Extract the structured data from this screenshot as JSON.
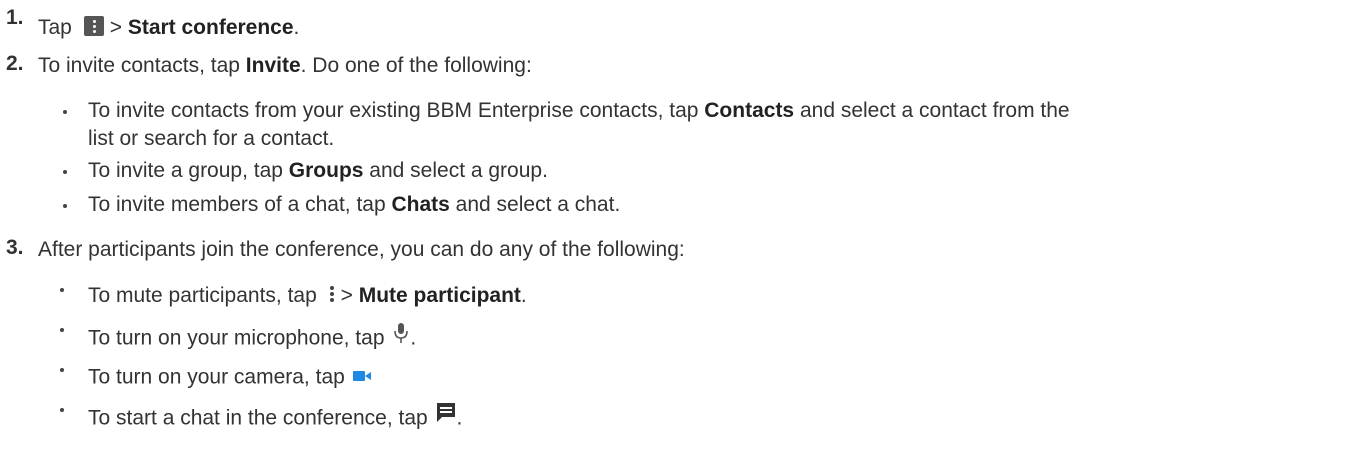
{
  "steps": [
    {
      "number": "1.",
      "parts": [
        "Tap",
        ">",
        "Start conference",
        "."
      ]
    },
    {
      "number": "2.",
      "parts": [
        "To invite contacts, tap ",
        "Invite",
        ". Do one of the following:"
      ],
      "bullets": [
        {
          "parts": [
            "To invite contacts from your existing BBM Enterprise contacts, tap ",
            "Contacts",
            " and select a contact from the"
          ],
          "continuation": "list or search for a contact."
        },
        {
          "parts": [
            "To invite a group, tap ",
            "Groups",
            " and select a group."
          ]
        },
        {
          "parts": [
            "To invite members of a chat, tap ",
            "Chats",
            " and select a chat."
          ]
        }
      ]
    },
    {
      "number": "3.",
      "parts": [
        "After participants join the conference, you can do any of the following:"
      ],
      "bullets": [
        {
          "parts": [
            "To mute participants, tap ",
            "> ",
            "Mute participant",
            "."
          ]
        },
        {
          "parts": [
            "To  turn on your microphone, tap ",
            "."
          ]
        },
        {
          "parts": [
            "To turn on your camera, tap "
          ]
        },
        {
          "parts": [
            "To start a chat in the conference, tap ",
            "."
          ]
        }
      ]
    }
  ],
  "icons": {
    "step1": "menu-icon",
    "mute": "more-vert-icon",
    "mic": "microphone-icon",
    "camera": "video-camera-icon",
    "chat": "chat-icon"
  },
  "colors": {
    "text": "#333333",
    "camera_icon": "#1e88e5"
  }
}
